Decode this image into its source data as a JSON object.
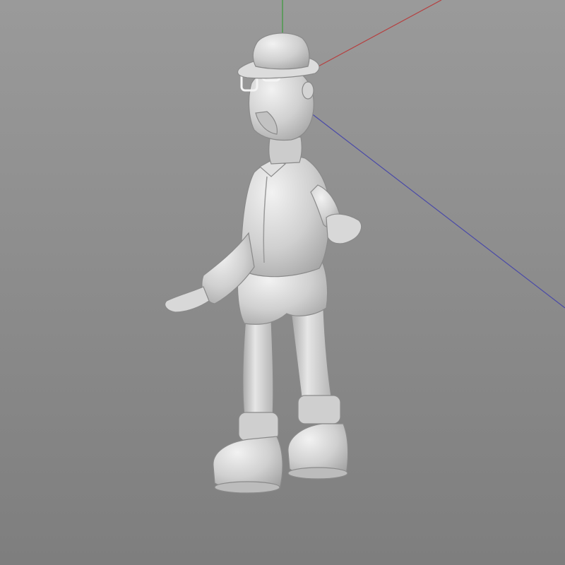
{
  "viewport": {
    "background_top": "#9a9a9a",
    "background_bottom": "#7e7e7e"
  },
  "axes": [
    {
      "name": "x-axis",
      "color": "#b64040"
    },
    {
      "name": "y-axis",
      "color": "#3a9a3a"
    },
    {
      "name": "z-axis",
      "color": "#4a4aa8"
    }
  ],
  "model": {
    "material_color": "#d2d2d2",
    "shadow_color": "#9e9e9e",
    "highlight_color": "#f0f0f0"
  }
}
